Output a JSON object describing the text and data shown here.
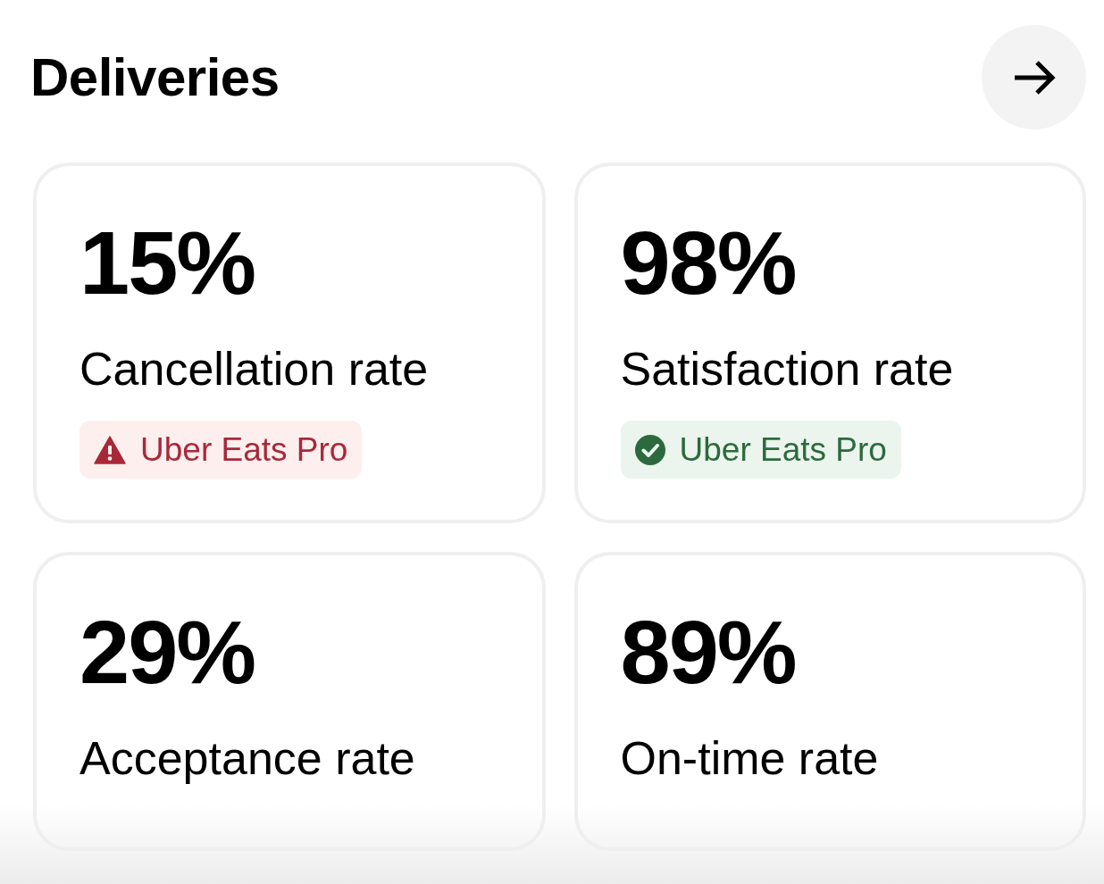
{
  "header": {
    "title": "Deliveries"
  },
  "metrics": [
    {
      "value": "15%",
      "label": "Cancellation rate",
      "badge": {
        "kind": "warning",
        "text": "Uber Eats Pro"
      }
    },
    {
      "value": "98%",
      "label": "Satisfaction rate",
      "badge": {
        "kind": "success",
        "text": "Uber Eats Pro"
      }
    },
    {
      "value": "29%",
      "label": "Acceptance rate"
    },
    {
      "value": "89%",
      "label": "On-time rate"
    }
  ]
}
